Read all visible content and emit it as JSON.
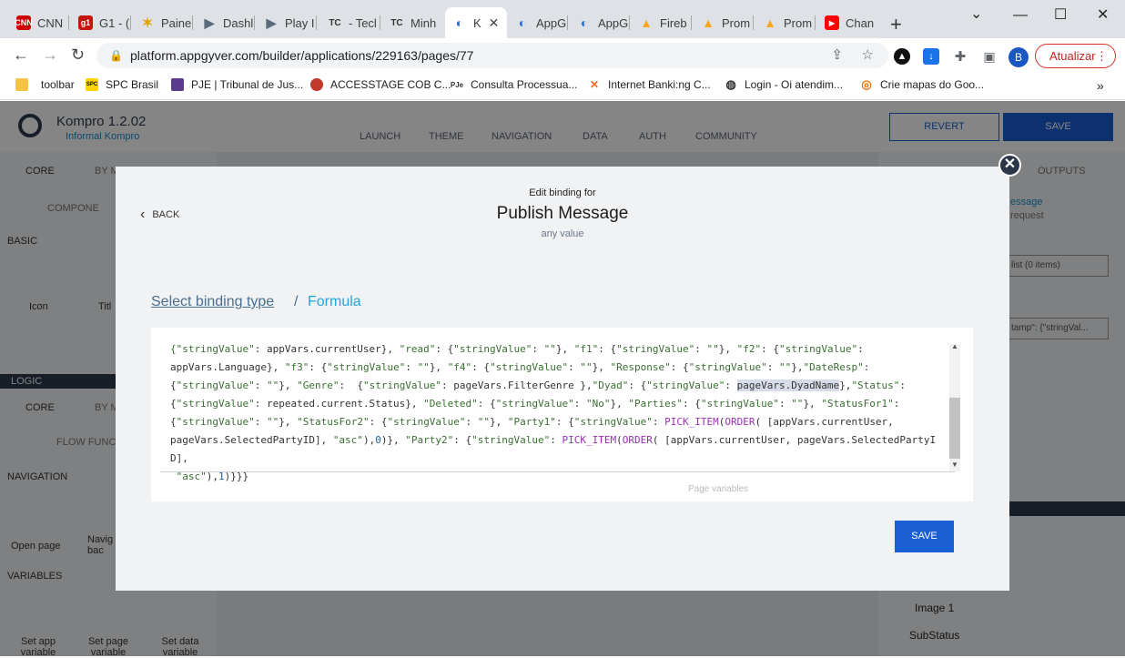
{
  "browser": {
    "tabs": [
      {
        "label": "CNN",
        "color": "#cc0000"
      },
      {
        "label": "G1 - (",
        "color": "#c4170c"
      },
      {
        "label": "Paine",
        "color": "#f4b400"
      },
      {
        "label": "Dashl",
        "color": "#5b6b7b"
      },
      {
        "label": "Play I",
        "color": "#5b6b7b"
      },
      {
        "label": "- Tecl",
        "color": "#3d3d3d"
      },
      {
        "label": "Minh",
        "color": "#3d3d3d"
      },
      {
        "label": "K",
        "color": "#2a6fdb"
      },
      {
        "label": "AppG",
        "color": "#2a6fdb"
      },
      {
        "label": "AppG",
        "color": "#2a6fdb"
      },
      {
        "label": "Fireb",
        "color": "#f5a623"
      },
      {
        "label": "Prom",
        "color": "#f5a623"
      },
      {
        "label": "Prom",
        "color": "#f5a623"
      },
      {
        "label": "Chan",
        "color": "#ff0000"
      }
    ],
    "url": "platform.appgyver.com/builder/applications/229163/pages/77",
    "update_label": "Atualizar",
    "profile_initial": "B",
    "bookmarks": [
      "toolbar",
      "SPC Brasil",
      "PJE | Tribunal de Jus...",
      "ACCESSTAGE COB C...",
      "Consulta Processua...",
      "Internet Banki:ng C...",
      "Login - Oi atendim...",
      "Crie mapas do Goo..."
    ]
  },
  "app": {
    "name": "Kompro 1.2.02",
    "subtitle": "Informal Kompro",
    "topnav": [
      "LAUNCH",
      "THEME",
      "NAVIGATION",
      "DATA",
      "AUTH",
      "COMMUNITY"
    ],
    "revert_label": "REVERT",
    "save_label": "SAVE",
    "left_tabs": [
      "CORE",
      "BY M"
    ],
    "component_search": "COMPONE",
    "basic_label": "BASIC",
    "basic_items": [
      "Icon",
      "Titl"
    ],
    "logic_label": "LOGIC",
    "logic_tabs": [
      "CORE",
      "BY M"
    ],
    "flow_search": "FLOW FUNC",
    "navigation_label": "NAVIGATION",
    "navigation_items": [
      "Open page",
      "Navig bac"
    ],
    "variables_label": "VARIABLES",
    "variable_items": [
      "Set app variable",
      "Set page variable",
      "Set data variable"
    ],
    "right_tab": "OUTPUTS",
    "right_link": "essage",
    "right_sub": "request",
    "right_field1": "list (0 items)",
    "right_field2": "tamp\": {\"stringVal...",
    "tree_items": [
      "Image 1",
      "SubStatus"
    ]
  },
  "modal": {
    "back_label": "BACK",
    "edit_for": "Edit binding for",
    "title": "Publish Message",
    "subtitle": "any value",
    "crumb_select": "Select binding type",
    "crumb_sep": "/",
    "crumb_current": "Formula",
    "page_variables_hint": "Page variables",
    "save_label": "SAVE"
  }
}
